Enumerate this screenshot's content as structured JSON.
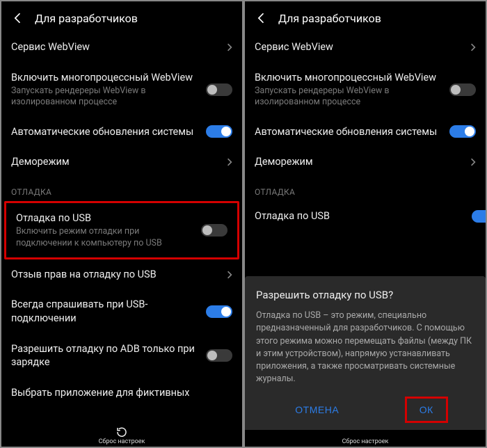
{
  "header": {
    "title": "Для разработчиков"
  },
  "rows": {
    "webview": {
      "title": "Сервис WebView"
    },
    "multiprocess": {
      "title": "Включить многопроцессный WebView",
      "sub": "Запускать рендереры WebView в изолированном процессе"
    },
    "auto_update": {
      "title": "Автоматические обновления системы"
    },
    "demo": {
      "title": "Деморежим"
    },
    "section_debug": "ОТЛАДКА",
    "usb_debug": {
      "title": "Отладка по USB",
      "sub": "Включить режим отладки при подключении к компьютеру по USB"
    },
    "revoke": {
      "title": "Отзыв прав на отладку по USB"
    },
    "always_ask": {
      "title": "Всегда спрашивать при USB-подключении"
    },
    "adb_charge": {
      "title": "Разрешить отладку по ADB только при зарядке"
    },
    "select_mock": {
      "title": "Выбрать приложение для фиктивных"
    }
  },
  "bottom": {
    "label": "Сброс настроек"
  },
  "dialog": {
    "title": "Разрешить отладку по USB?",
    "body": "Отладка по USB – это режим, специально предназначенный для разработчиков. С помощью этого режима можно перемещать файлы (между ПК и этим устройством), напрямую устанавливать приложения, а также просматривать системные журналы.",
    "cancel": "ОТМЕНА",
    "ok": "ОК"
  }
}
